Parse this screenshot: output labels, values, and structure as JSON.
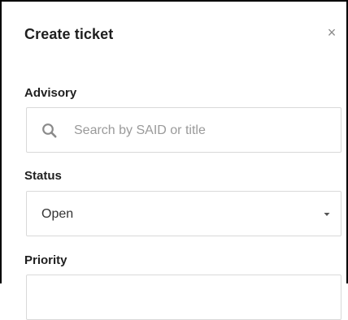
{
  "dialog": {
    "title": "Create ticket",
    "close_glyph": "×",
    "close_icon": "close-icon"
  },
  "advisory": {
    "label": "Advisory",
    "placeholder": "Search by SAID or title",
    "icon": "search-icon"
  },
  "status": {
    "label": "Status",
    "selected": "Open",
    "icon": "chevron-down-icon"
  },
  "priority": {
    "label": "Priority"
  },
  "colors": {
    "placeholder_text": "#9a9a9a",
    "border": "#d9d9d9",
    "icon": "#8a8a8a"
  }
}
